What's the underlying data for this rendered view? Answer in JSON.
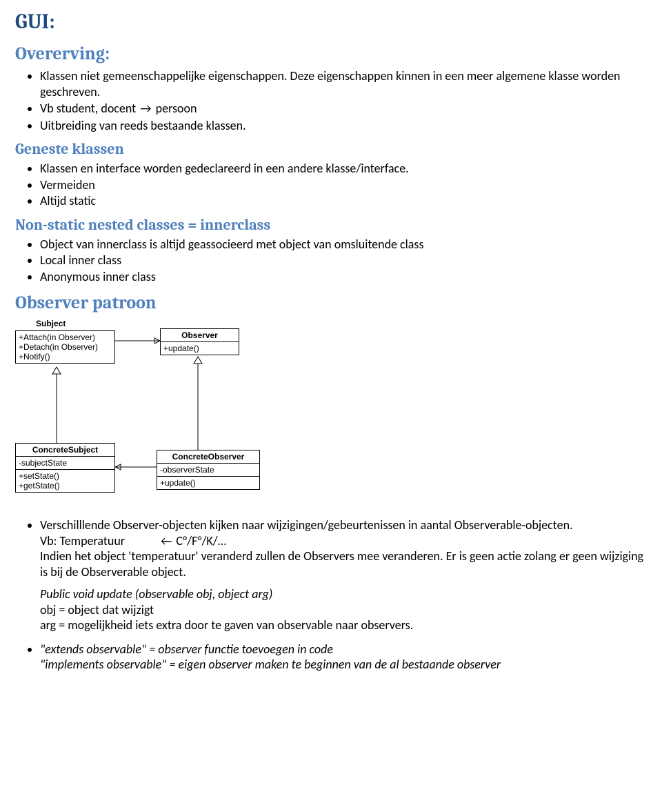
{
  "headings": {
    "h1": "GUI:",
    "h2_inherit": "Overerving:",
    "h3_nested": "Geneste klassen",
    "h3_nonstatic": "Non-static nested classes = innerclass",
    "h2_observer": "Observer patroon"
  },
  "inherit_items": [
    "Klassen niet gemeenschappelijke eigenschappen. Deze eigenschappen kinnen in een meer algemene klasse worden geschreven.",
    {
      "pre": "Vb student, docent ",
      "arrow": "→",
      "post": " persoon"
    },
    "Uitbreiding van reeds bestaande klassen."
  ],
  "nested_items": [
    "Klassen en interface worden gedeclareerd in een andere klasse/interface.",
    "Vermeiden",
    "Altijd static"
  ],
  "nonstatic_items": [
    "Object van innerclass is altijd geassocieerd met object van omsluitende class",
    "Local inner class",
    "Anonymous inner class"
  ],
  "uml": {
    "subject_label": "Subject",
    "observer_label": "Observer",
    "concrete_subject_label": "ConcreteSubject",
    "concrete_observer_label": "ConcreteObserver",
    "subject_ops": [
      "+Attach(in Observer)",
      "+Detach(in Observer)",
      "+Notify()"
    ],
    "observer_ops": [
      "+update()"
    ],
    "cs_attrs": [
      "-subjectState"
    ],
    "cs_ops": [
      "+setState()",
      "+getState()"
    ],
    "co_attrs": [
      "-observerState"
    ],
    "co_ops": [
      "+update()"
    ]
  },
  "observer_block": {
    "item1_a": "Verschilllende Observer-objecten kijken naar wijzigingen/gebeurtenissen in aantal Observerable-objecten.",
    "item1_b_pre": "Vb: Temperatuur",
    "item1_b_arrow": "←",
    "item1_b_post": " C°/F°/K/…",
    "item1_c": "Indien het object 'temperatuur' veranderd zullen de Observers mee veranderen. Er is geen actie zolang er geen wijziging is bij de Observerable object.",
    "item1_d_italic": "Public void update (observable obj, object arg)",
    "item1_e": "obj = object dat wijzigt",
    "item1_f": "arg = mogelijkheid iets extra door te gaven van observable naar observers.",
    "item2": "\"extends observable\" = observer functie toevoegen in code",
    "item2b": "\"implements observable\" = eigen observer maken te beginnen van de al bestaande observer"
  }
}
